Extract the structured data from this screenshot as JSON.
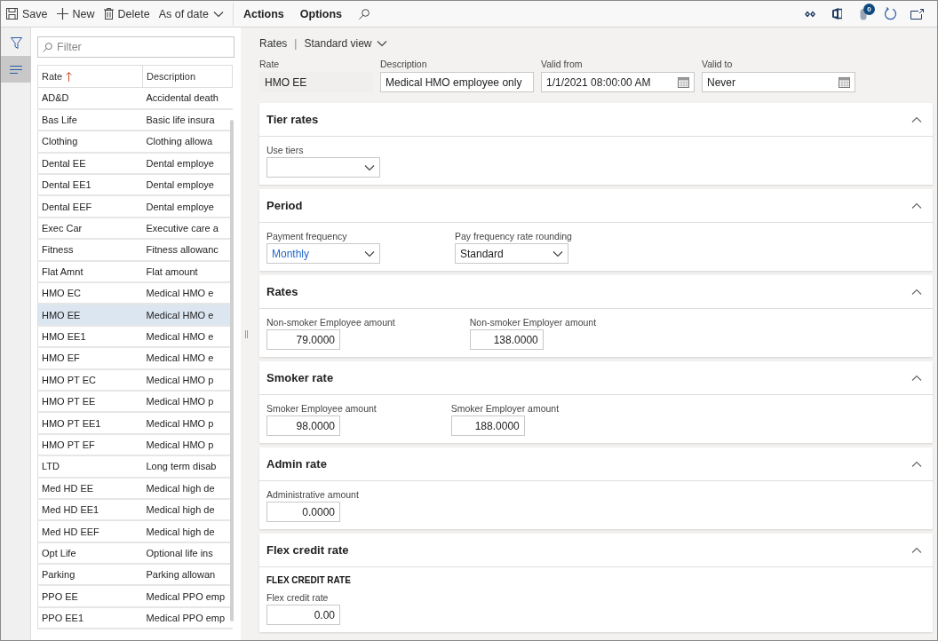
{
  "toolbar": {
    "items": [
      {
        "kind": "save",
        "label": "Save"
      },
      {
        "kind": "new",
        "label": "New"
      },
      {
        "kind": "delete",
        "label": "Delete"
      },
      {
        "kind": "dropdown",
        "label": "As of date"
      },
      {
        "kind": "menu",
        "label": "Actions"
      },
      {
        "kind": "menu",
        "label": "Options"
      },
      {
        "kind": "search"
      }
    ],
    "right_icons": [
      {
        "kind": "links"
      },
      {
        "kind": "office"
      },
      {
        "kind": "attachments",
        "badge": "0"
      },
      {
        "kind": "refresh"
      },
      {
        "kind": "popout"
      }
    ]
  },
  "nav": {
    "items": [
      {
        "kind": "filter",
        "selected": false
      },
      {
        "kind": "list",
        "selected": true
      }
    ]
  },
  "list": {
    "filter_placeholder": "Filter",
    "columns": [
      {
        "label": "Rate",
        "sorted": true
      },
      {
        "label": "Description"
      }
    ],
    "rows": [
      {
        "rate": "AD&D",
        "description": "Accidental death",
        "selected": false
      },
      {
        "rate": "Bas Life",
        "description": "Basic life insura",
        "selected": false
      },
      {
        "rate": "Clothing",
        "description": "Clothing allowa",
        "selected": false
      },
      {
        "rate": "Dental EE",
        "description": "Dental employe",
        "selected": false
      },
      {
        "rate": "Dental EE1",
        "description": "Dental employe",
        "selected": false
      },
      {
        "rate": "Dental EEF",
        "description": "Dental employe",
        "selected": false
      },
      {
        "rate": "Exec Car",
        "description": "Executive care a",
        "selected": false
      },
      {
        "rate": "Fitness",
        "description": "Fitness allowanc",
        "selected": false
      },
      {
        "rate": "Flat Amnt",
        "description": "Flat amount",
        "selected": false
      },
      {
        "rate": "HMO EC",
        "description": "Medical HMO e",
        "selected": false
      },
      {
        "rate": "HMO EE",
        "description": "Medical HMO e",
        "selected": true
      },
      {
        "rate": "HMO EE1",
        "description": "Medical HMO e",
        "selected": false
      },
      {
        "rate": "HMO EF",
        "description": "Medical HMO e",
        "selected": false
      },
      {
        "rate": "HMO PT EC",
        "description": "Medical HMO p",
        "selected": false
      },
      {
        "rate": "HMO PT EE",
        "description": "Medical HMO p",
        "selected": false
      },
      {
        "rate": "HMO PT EE1",
        "description": "Medical HMO p",
        "selected": false
      },
      {
        "rate": "HMO PT EF",
        "description": "Medical HMO p",
        "selected": false
      },
      {
        "rate": "LTD",
        "description": "Long term disab",
        "selected": false
      },
      {
        "rate": "Med HD EE",
        "description": "Medical high de",
        "selected": false
      },
      {
        "rate": "Med HD EE1",
        "description": "Medical high de",
        "selected": false
      },
      {
        "rate": "Med HD EEF",
        "description": "Medical high de",
        "selected": false
      },
      {
        "rate": "Opt Life",
        "description": "Optional life ins",
        "selected": false
      },
      {
        "rate": "Parking",
        "description": "Parking allowan",
        "selected": false
      },
      {
        "rate": "PPO EE",
        "description": "Medical PPO emp",
        "selected": false
      },
      {
        "rate": "PPO EE1",
        "description": "Medical PPO emp",
        "selected": false
      }
    ]
  },
  "breadcrumb": {
    "page": "Rates",
    "separator": "|",
    "view": "Standard view"
  },
  "header_fields": [
    {
      "kind": "readonly",
      "label": "Rate",
      "value": "HMO EE"
    },
    {
      "kind": "text",
      "label": "Description",
      "value": "Medical HMO employee only"
    },
    {
      "kind": "date",
      "label": "Valid from",
      "value": "1/1/2021 08:00:00 AM"
    },
    {
      "kind": "date",
      "label": "Valid to",
      "value": "Never"
    }
  ],
  "sections": [
    {
      "title": "Tier rates",
      "expanded": true,
      "fields": [
        {
          "kind": "dropdown",
          "label": "Use tiers"
        }
      ]
    },
    {
      "title": "Period",
      "expanded": true,
      "fields": [
        {
          "kind": "dropdown",
          "label": "Payment frequency",
          "value": "Monthly",
          "link": true
        },
        {
          "kind": "dropdown",
          "label": "Pay frequency rate rounding",
          "value": "Standard",
          "link": false
        }
      ]
    },
    {
      "title": "Rates",
      "expanded": true,
      "fields": [
        {
          "kind": "number",
          "label": "Non-smoker Employee amount",
          "value": "79.0000"
        },
        {
          "kind": "number",
          "label": "Non-smoker Employer amount",
          "value": "138.0000"
        }
      ]
    },
    {
      "title": "Smoker rate",
      "expanded": true,
      "fields": [
        {
          "kind": "number",
          "label": "Smoker Employee amount",
          "value": "98.0000"
        },
        {
          "kind": "number",
          "label": "Smoker Employer amount",
          "value": "188.0000"
        }
      ]
    },
    {
      "title": "Admin rate",
      "expanded": true,
      "fields": [
        {
          "kind": "number",
          "label": "Administrative amount",
          "value": "0.0000"
        }
      ]
    },
    {
      "title": "Flex credit rate",
      "expanded": true,
      "subheading": "FLEX CREDIT RATE",
      "fields": [
        {
          "kind": "number",
          "label": "Flex credit rate",
          "value": "0.00"
        }
      ]
    }
  ]
}
